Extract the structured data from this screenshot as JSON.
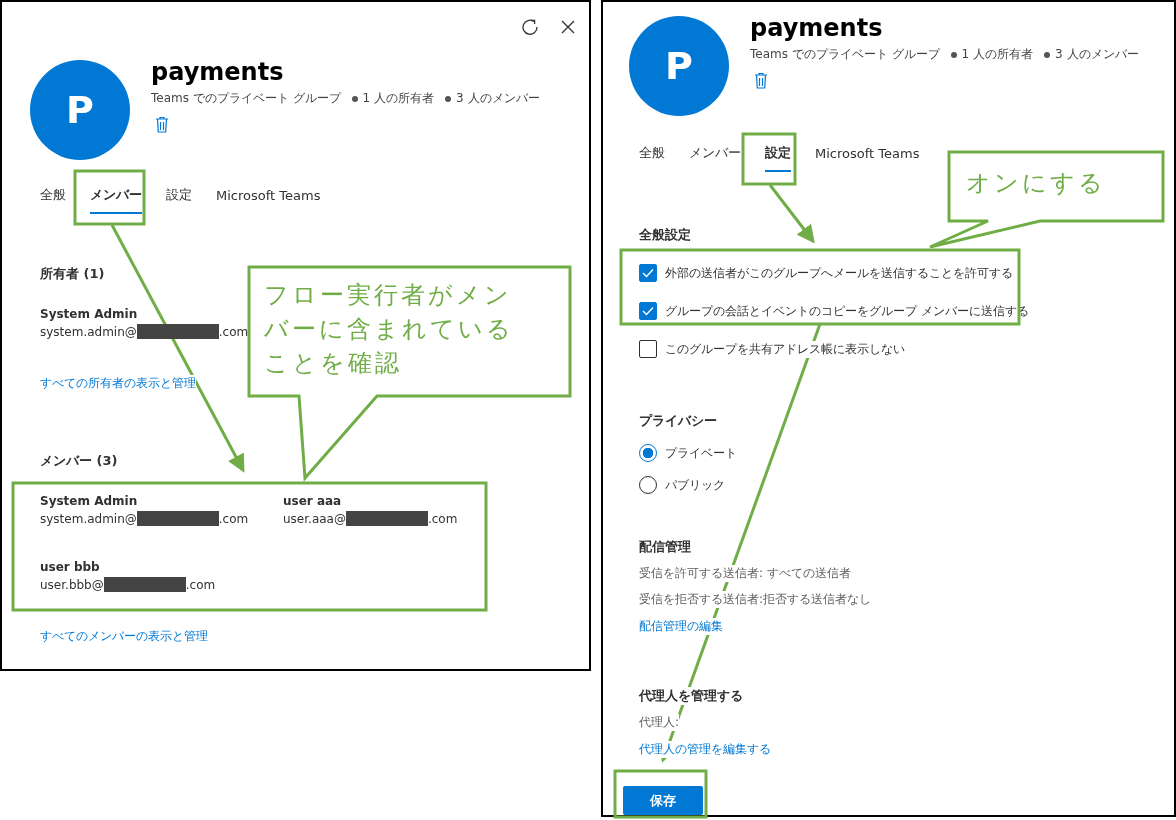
{
  "panels": [
    {
      "kind": "members",
      "avatar_letter": "P",
      "title": "payments",
      "subtitle": [
        "Teams でのプライベート グループ",
        "1 人の所有者",
        "3 人のメンバー"
      ],
      "tabs": [
        {
          "label": "全般",
          "selected": false
        },
        {
          "label": "メンバー",
          "selected": true
        },
        {
          "label": "設定",
          "selected": false
        },
        {
          "label": "Microsoft Teams",
          "selected": false
        }
      ],
      "sections": [
        {
          "heading": "所有者 (1)",
          "people": [
            {
              "name": "System Admin",
              "email_start": "system.admin@",
              "email_end": ".com"
            }
          ],
          "link": "すべての所有者の表示と管理"
        },
        {
          "heading": "メンバー (3)",
          "people": [
            {
              "name": "System Admin",
              "email_start": "system.admin@",
              "email_end": ".com"
            },
            {
              "name": "user aaa",
              "email_start": "user.aaa@",
              "email_end": ".com"
            },
            {
              "name": "user bbb",
              "email_start": "user.bbb@",
              "email_end": ".com"
            }
          ],
          "link": "すべてのメンバーの表示と管理"
        }
      ]
    },
    {
      "kind": "settings",
      "avatar_letter": "P",
      "title": "payments",
      "subtitle": [
        "Teams でのプライベート グループ",
        "1 人の所有者",
        "3 人のメンバー"
      ],
      "tabs": [
        {
          "label": "全般",
          "selected": false
        },
        {
          "label": "メンバー",
          "selected": false
        },
        {
          "label": "設定",
          "selected": true
        },
        {
          "label": "Microsoft Teams",
          "selected": false
        }
      ],
      "sections": [
        {
          "kind": "checkboxes",
          "heading": "全般設定",
          "items": [
            {
              "label": "外部の送信者がこのグループへメールを送信することを許可する",
              "checked": true
            },
            {
              "label": "グループの会話とイベントのコピーをグループ メンバーに送信する",
              "checked": true
            },
            {
              "label": "このグループを共有アドレス帳に表示しない",
              "checked": false
            }
          ]
        },
        {
          "kind": "radios",
          "heading": "プライバシー",
          "items": [
            {
              "label": "プライベート",
              "selected": true
            },
            {
              "label": "パブリック",
              "selected": false
            }
          ]
        },
        {
          "kind": "info",
          "heading": "配信管理",
          "lines": [
            "受信を許可する送信者: すべての送信者",
            "受信を拒否する送信者:拒否する送信者なし"
          ],
          "link": "配信管理の編集"
        },
        {
          "kind": "info",
          "heading": "代理人を管理する",
          "lines": [
            "代理人:"
          ],
          "link": "代理人の管理を編集する"
        }
      ],
      "save_button": "保存"
    }
  ],
  "callouts": [
    {
      "lines": [
        "フロー実行者がメン",
        "バーに含まれている",
        "ことを確認"
      ]
    },
    {
      "lines": [
        "オンにする"
      ]
    }
  ]
}
